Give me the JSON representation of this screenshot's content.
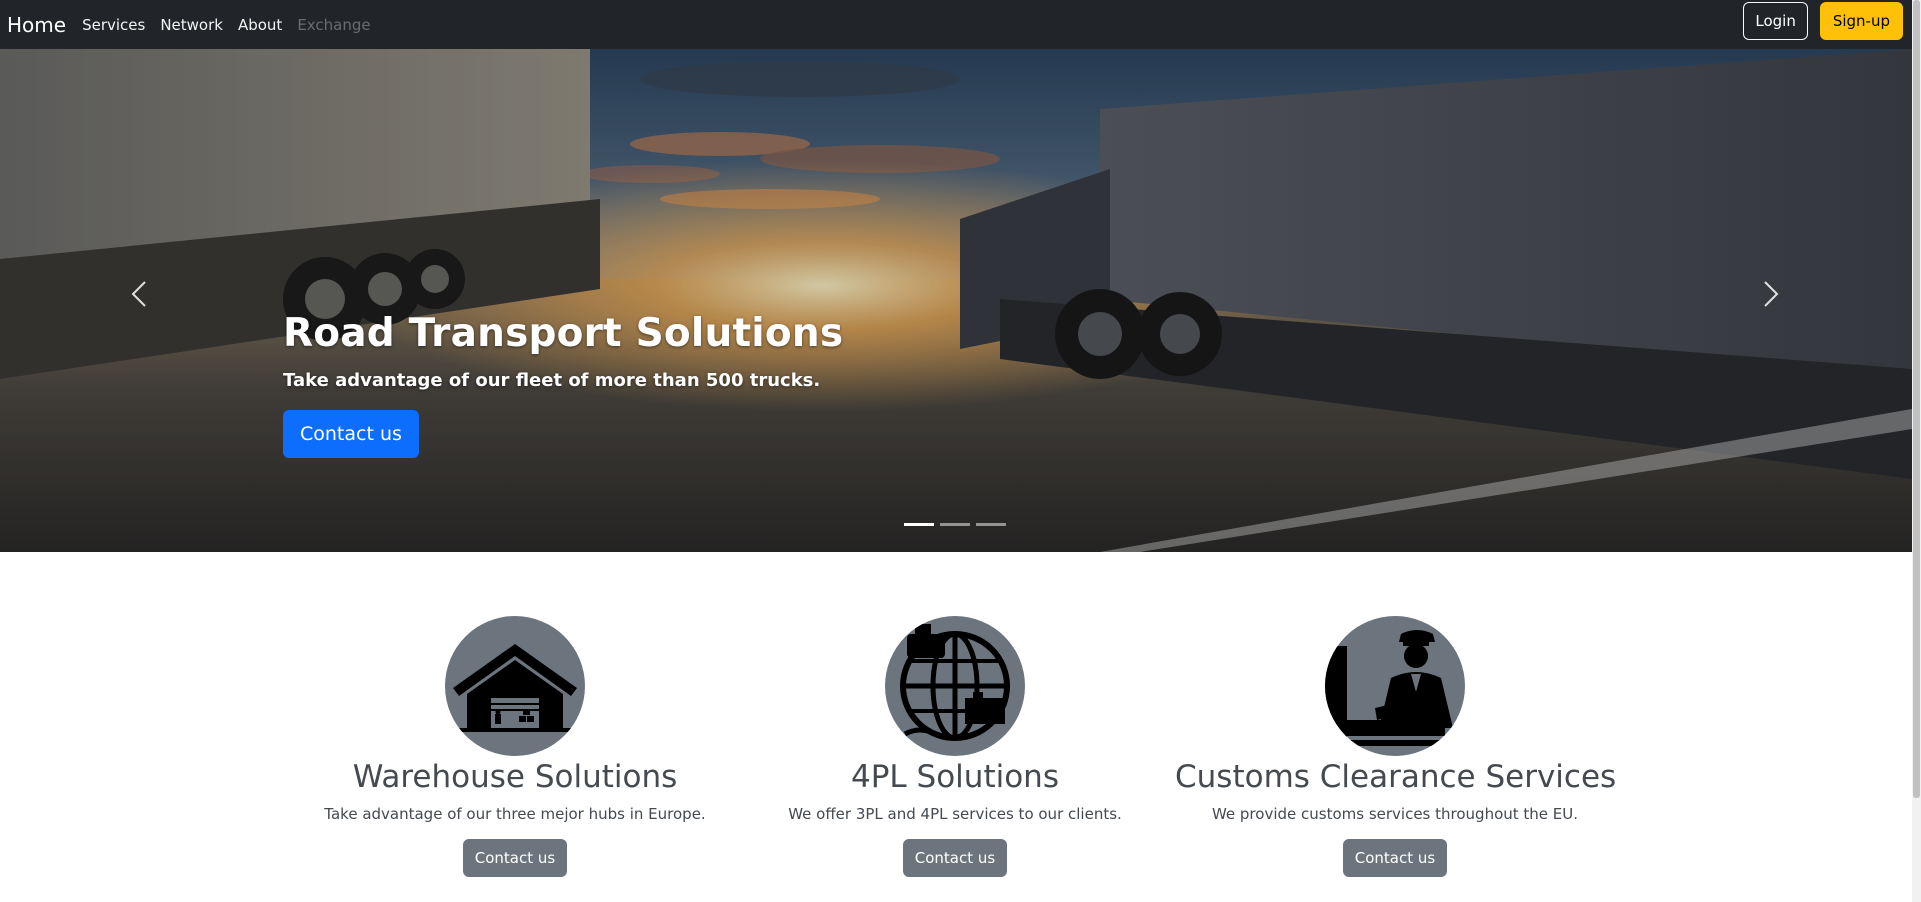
{
  "navbar": {
    "brand": "Home",
    "links": [
      {
        "label": "Services",
        "disabled": false
      },
      {
        "label": "Network",
        "disabled": false
      },
      {
        "label": "About",
        "disabled": false
      },
      {
        "label": "Exchange",
        "disabled": true
      }
    ],
    "login_label": "Login",
    "signup_label": "Sign-up"
  },
  "hero": {
    "title": "Road Transport Solutions",
    "subtitle": "Take advantage of our fleet of more than 500 trucks.",
    "button_label": "Contact us",
    "prev_icon": "chevron-left-icon",
    "next_icon": "chevron-right-icon",
    "slide_count": 3,
    "active_slide": 1
  },
  "services": [
    {
      "icon": "warehouse-icon",
      "title": "Warehouse Solutions",
      "text": "Take advantage of our three mejor hubs in Europe.",
      "button_label": "Contact us"
    },
    {
      "icon": "globe-logistics-icon",
      "title": "4PL Solutions",
      "text": "We offer 3PL and 4PL services to our clients.",
      "button_label": "Contact us"
    },
    {
      "icon": "customs-officer-icon",
      "title": "Customs Clearance Services",
      "text": "We provide customs services throughout the EU.",
      "button_label": "Contact us"
    }
  ],
  "colors": {
    "navbar_bg": "#212529",
    "primary": "#0d6efd",
    "warning": "#ffc107",
    "secondary": "#6c757d"
  }
}
